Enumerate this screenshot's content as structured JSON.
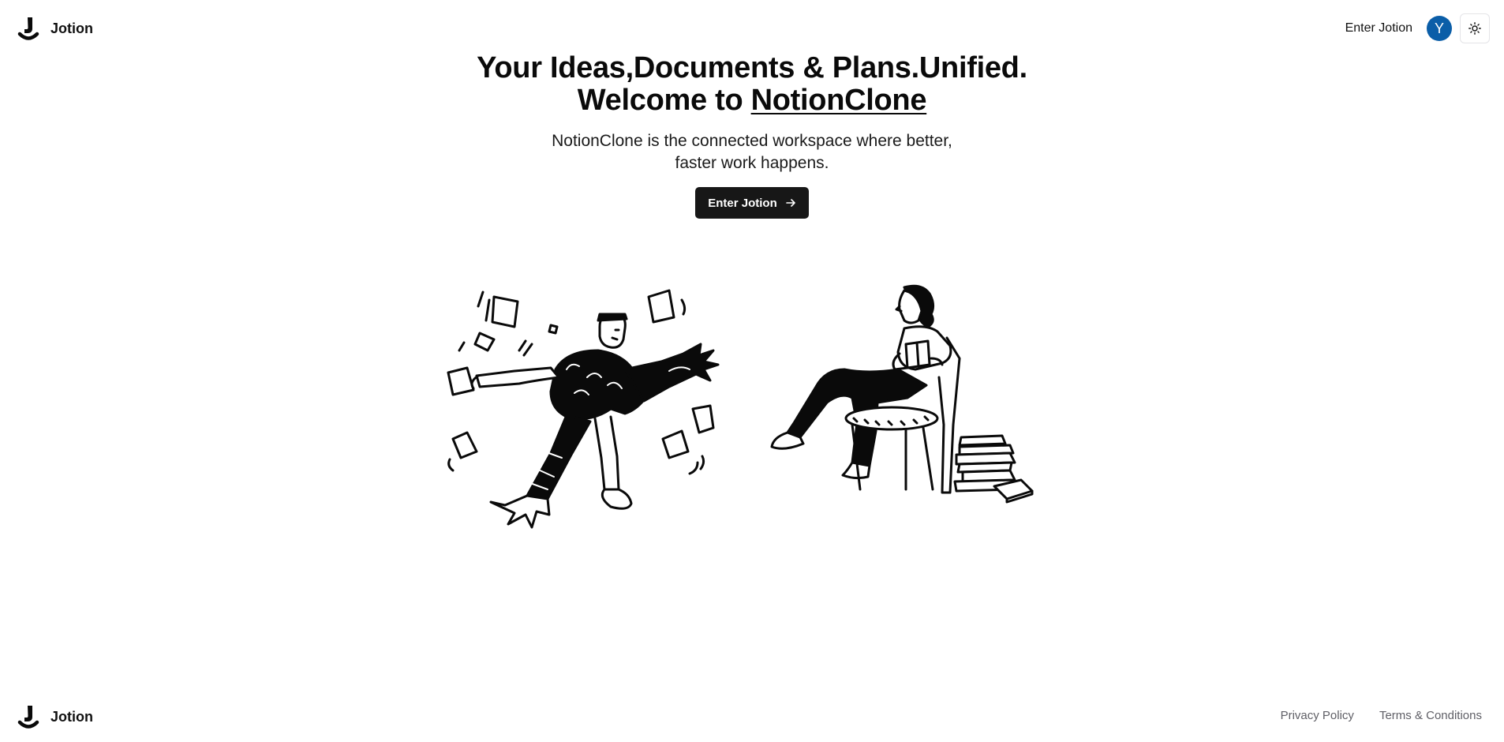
{
  "navbar": {
    "brand_name": "Jotion",
    "enter_link": "Enter Jotion",
    "avatar_initial": "Y",
    "avatar_color": "#0b5ea8",
    "theme_icon": "sun-icon"
  },
  "hero": {
    "heading_line1": "Your Ideas,Documents & Plans.Unified.",
    "heading_line2_prefix": "Welcome to ",
    "heading_brand": "NotionClone",
    "subtitle": "NotionClone is the connected workspace where better, faster work happens.",
    "cta_label": "Enter Jotion",
    "cta_icon": "arrow-right-icon",
    "cta_color": "#171717"
  },
  "illustrations": {
    "left": "juggling-papers-illustration",
    "right": "reading-woman-illustration"
  },
  "footer": {
    "brand_name": "Jotion",
    "links": [
      "Privacy Policy",
      "Terms & Conditions"
    ]
  }
}
